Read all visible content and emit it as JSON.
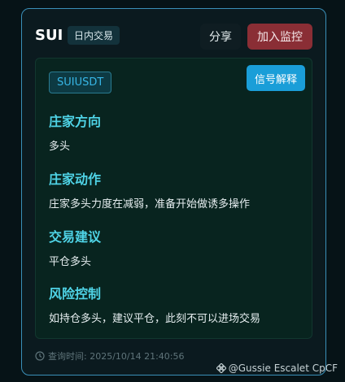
{
  "header": {
    "symbol": "SUI",
    "tag": "日内交易",
    "share_label": "分享",
    "monitor_label": "加入监控"
  },
  "panel": {
    "pair": "SUIUSDT",
    "signal_button": "信号解释",
    "sections": [
      {
        "title": "庄家方向",
        "body": "多头"
      },
      {
        "title": "庄家动作",
        "body": "庄家多头力度在减弱，准备开始做诱多操作"
      },
      {
        "title": "交易建议",
        "body": "平仓多头"
      },
      {
        "title": "风险控制",
        "body": "如持仓多头，建议平仓，此刻不可以进场交易"
      }
    ]
  },
  "footer": {
    "query_time": "查询时间: 2025/10/14 21:40:56"
  },
  "watermark": {
    "text": "@Gussie Escalet CpCF",
    "icon": "binance-logo-icon"
  },
  "colors": {
    "accent_title": "#4fd3e6",
    "monitor_button": "#8a2e35",
    "signal_button": "#1a9ed8"
  }
}
